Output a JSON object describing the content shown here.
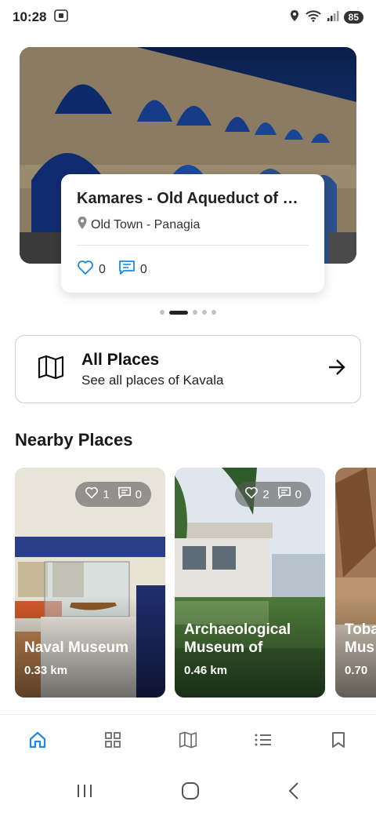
{
  "status_bar": {
    "time": "10:28",
    "battery": "85"
  },
  "hero": {
    "title": "Kamares - Old Aqueduct of Ka...",
    "location": "Old Town - Panagia",
    "likes": "0",
    "comments": "0",
    "dots_count": 5,
    "active_dot": 1
  },
  "all_places": {
    "title": "All Places",
    "subtitle": "See all places of Kavala"
  },
  "nearby": {
    "title": "Nearby Places",
    "cards": [
      {
        "name": "Naval Museum",
        "distance": "0.33 km",
        "likes": "1",
        "comments": "0"
      },
      {
        "name": "Archaeological Museum of",
        "distance": "0.46 km",
        "likes": "2",
        "comments": "0"
      },
      {
        "name": "Toba Mus",
        "distance": "0.70"
      }
    ]
  },
  "bottom_nav": [
    "home-icon",
    "grid-icon",
    "map-icon",
    "list-icon",
    "bookmark-icon"
  ],
  "colors": {
    "accent": "#1e88e5",
    "text": "#1a1a1a",
    "inactive_nav": "#6b6b6b"
  }
}
